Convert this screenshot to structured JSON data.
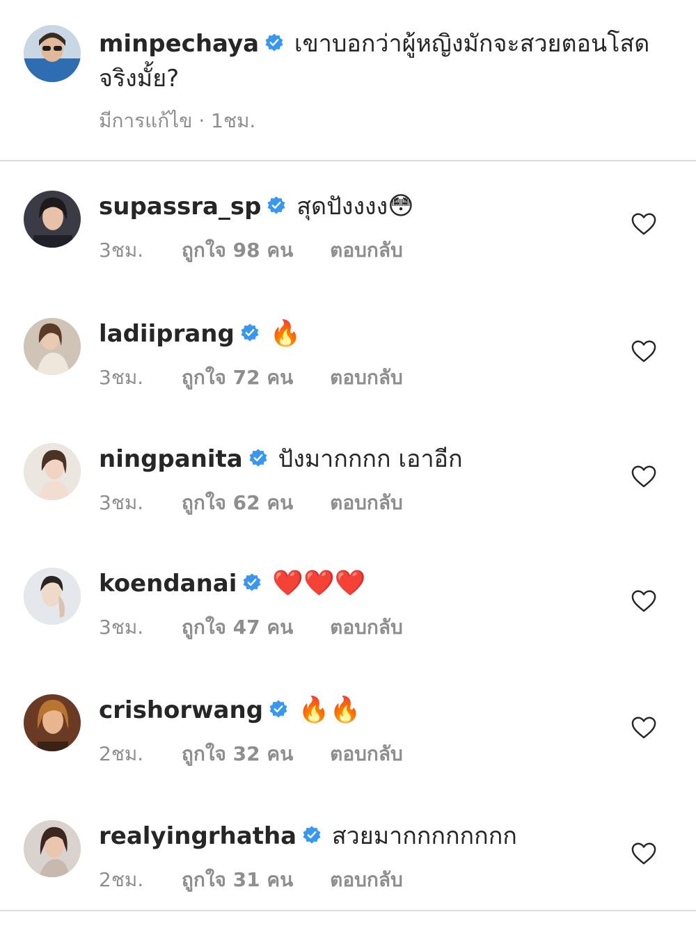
{
  "caption": {
    "username": "minpechaya",
    "text": "เขาบอกว่าผู้หญิงมักจะสวยตอนโสด จริงมั้ย?",
    "edited": "มีการแก้ไข",
    "separator": "·",
    "time": "1ชม."
  },
  "comments": [
    {
      "username": "supassra_sp",
      "text": "สุดปังงงง",
      "emoji": "😳",
      "time": "3ชม.",
      "likes": "ถูกใจ 98 คน",
      "reply": "ตอบกลับ"
    },
    {
      "username": "ladiiprang",
      "text": "",
      "emoji": "🔥",
      "time": "3ชม.",
      "likes": "ถูกใจ 72 คน",
      "reply": "ตอบกลับ"
    },
    {
      "username": "ningpanita",
      "text": "ปังมากกกก เอาอีก",
      "emoji": "",
      "time": "3ชม.",
      "likes": "ถูกใจ 62 คน",
      "reply": "ตอบกลับ"
    },
    {
      "username": "koendanai",
      "text": "",
      "emoji": "❤️❤️❤️",
      "time": "3ชม.",
      "likes": "ถูกใจ 47 คน",
      "reply": "ตอบกลับ"
    },
    {
      "username": "crishorwang",
      "text": "",
      "emoji": "🔥🔥",
      "time": "2ชม.",
      "likes": "ถูกใจ 32 คน",
      "reply": "ตอบกลับ"
    },
    {
      "username": "realyingrhatha",
      "text": "สวยมากกกกกกกก",
      "emoji": "",
      "time": "2ชม.",
      "likes": "ถูกใจ 31 คน",
      "reply": "ตอบกลับ"
    }
  ],
  "colors": {
    "text": "#262626",
    "secondary": "#8e8e8e",
    "verified": "#3897f0",
    "divider": "#dbdbdb"
  },
  "icons": {
    "verified": "verified-badge-icon",
    "like": "heart-outline-icon"
  }
}
